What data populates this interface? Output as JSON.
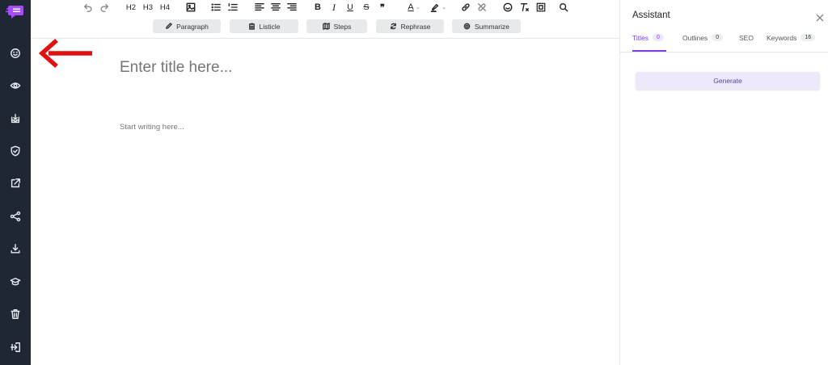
{
  "toolbar": {
    "h2": "H2",
    "h3": "H3",
    "h4": "H4",
    "bold": "B",
    "italic": "I",
    "underline": "U",
    "strike": "S",
    "quote": "❞",
    "font_color": "A"
  },
  "actions": {
    "paragraph": "Paragraph",
    "listicle": "Listicle",
    "steps": "Steps",
    "rephrase": "Rephrase",
    "summarize": "Summarize"
  },
  "editor": {
    "title_placeholder": "Enter title here...",
    "body_placeholder": "Start writing here..."
  },
  "assistant": {
    "title": "Assistant",
    "tabs": [
      {
        "label": "Titles",
        "count": "0"
      },
      {
        "label": "Outlines",
        "count": "0"
      },
      {
        "label": "SEO"
      },
      {
        "label": "Keywords",
        "count": "16"
      }
    ],
    "generate": "Generate"
  },
  "colors": {
    "sidebar": "#1f2735",
    "accent": "#7b3fe4",
    "logo": "#a64df5",
    "annotation_arrow": "#e01010"
  },
  "icons": [
    "logo-icon",
    "smiley-icon",
    "eye-icon",
    "save-tray-icon",
    "shield-icon",
    "external-link-icon",
    "share-icon",
    "download-icon",
    "graduation-cap-icon",
    "trash-icon",
    "logout-icon"
  ]
}
